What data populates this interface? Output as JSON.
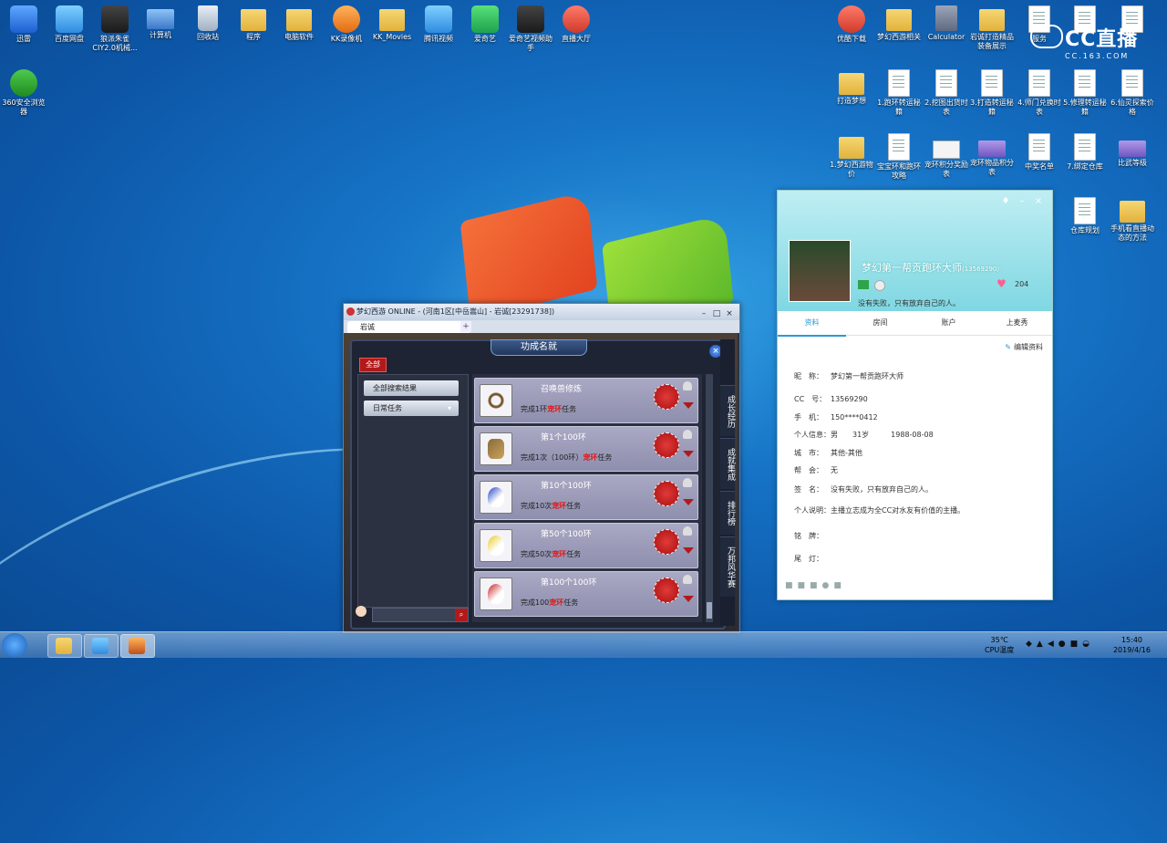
{
  "desktop_left": [
    {
      "label": "迅雷",
      "x": 0
    },
    {
      "label": "百度网盘",
      "x": 1
    },
    {
      "label": "狼派朱雀 CIY2.0机械...",
      "x": 2
    },
    {
      "label": "计算机",
      "x": 3
    },
    {
      "label": "回收站",
      "x": 4
    },
    {
      "label": "程序",
      "x": 5
    },
    {
      "label": "电脑软件",
      "x": 6
    },
    {
      "label": "KK录像机",
      "x": 7
    },
    {
      "label": "KK_Movies",
      "x": 8
    },
    {
      "label": "腾讯视频",
      "x": 9
    },
    {
      "label": "爱奇艺",
      "x": 10
    },
    {
      "label": "爱奇艺视频助手",
      "x": 11
    },
    {
      "label": "直播大厅",
      "x": 12
    }
  ],
  "desktop_360": "360安全浏览器",
  "desktop_right_row1": [
    "优酷下载",
    "梦幻西游相关",
    "Calculator",
    "岩诚打造精品装备展示",
    "服务",
    "",
    ""
  ],
  "desktop_right_row2": [
    "打造梦想",
    "1.跑环转运秘籍",
    "2.挖图出货时表",
    "3.打造转运秘籍",
    "4.师门兑换时表",
    "5.修理转运秘籍",
    "6.仙灵探索价格"
  ],
  "desktop_right_row3": [
    "1.梦幻西游物价",
    "宝宝环和跑环攻略",
    "宠环积分奖励表",
    "宠环物品积分表",
    "中奖名单",
    "7.绑定仓库",
    "比武等级"
  ],
  "desktop_right_row4": [
    "仓库规划",
    "手机看直播动态的方法"
  ],
  "cc_logo": {
    "big": "CC直播",
    "small": "CC.163.COM"
  },
  "game": {
    "title": "梦幻西游 ONLINE - (河南1区[中岳嵩山] - 岩诚[23291738])",
    "tab": "岩诚",
    "panel_title": "功成名就",
    "tag_all": "全部",
    "left_buttons": [
      "全部搜索结果",
      "日常任务"
    ],
    "rows": [
      {
        "title": "召唤兽修炼",
        "desc_pre": "完成1环",
        "desc_hl": "宠环",
        "desc_post": "任务",
        "pic": "chain"
      },
      {
        "title": "第1个100环",
        "desc_pre": "完成1次（100环）",
        "desc_hl": "宠环",
        "desc_post": "任务",
        "pic": "claw"
      },
      {
        "title": "第10个100环",
        "desc_pre": "完成10次",
        "desc_hl": "宠环",
        "desc_post": "任务",
        "pic": "bird-blue"
      },
      {
        "title": "第50个100环",
        "desc_pre": "完成50次",
        "desc_hl": "宠环",
        "desc_post": "任务",
        "pic": "bird-yellow"
      },
      {
        "title": "第100个100环",
        "desc_pre": "完成100",
        "desc_hl": "宠环",
        "desc_post": "任务",
        "pic": "bird-red"
      }
    ],
    "side_tabs": [
      "成长经历",
      "成就集成",
      "排行榜",
      "万邦风华赛"
    ]
  },
  "cc": {
    "name": "梦幻第一帮贡跑环大师",
    "id": "(13569290)",
    "likes": "204",
    "motto": "没有失败，只有放弃自己的人。",
    "tabs": [
      "资料",
      "房间",
      "账户",
      "上麦秀"
    ],
    "edit": "编辑资料",
    "info": [
      {
        "k": "昵　称：",
        "v": "梦幻第一帮贡跑环大师"
      },
      {
        "k": "CC　号：",
        "v": "13569290"
      },
      {
        "k": "手　机：",
        "v": "150****0412"
      },
      {
        "k": "个人信息：",
        "v": "男　　31岁　　　1988-08-08"
      },
      {
        "k": "城　市：",
        "v": "其他-其他"
      },
      {
        "k": "帮　会：",
        "v": "无"
      },
      {
        "k": "签　名：",
        "v": "没有失败，只有放弃自己的人。"
      },
      {
        "k": "个人说明：",
        "v": "主播立志成为全CC对水友有价值的主播。"
      },
      {
        "k": "铭　牌：",
        "v": ""
      },
      {
        "k": "尾　灯：",
        "v": ""
      }
    ]
  },
  "taskbar": {
    "temp": "35℃",
    "temp_label": "CPU温度",
    "time": "15:40",
    "date": "2019/4/16"
  }
}
